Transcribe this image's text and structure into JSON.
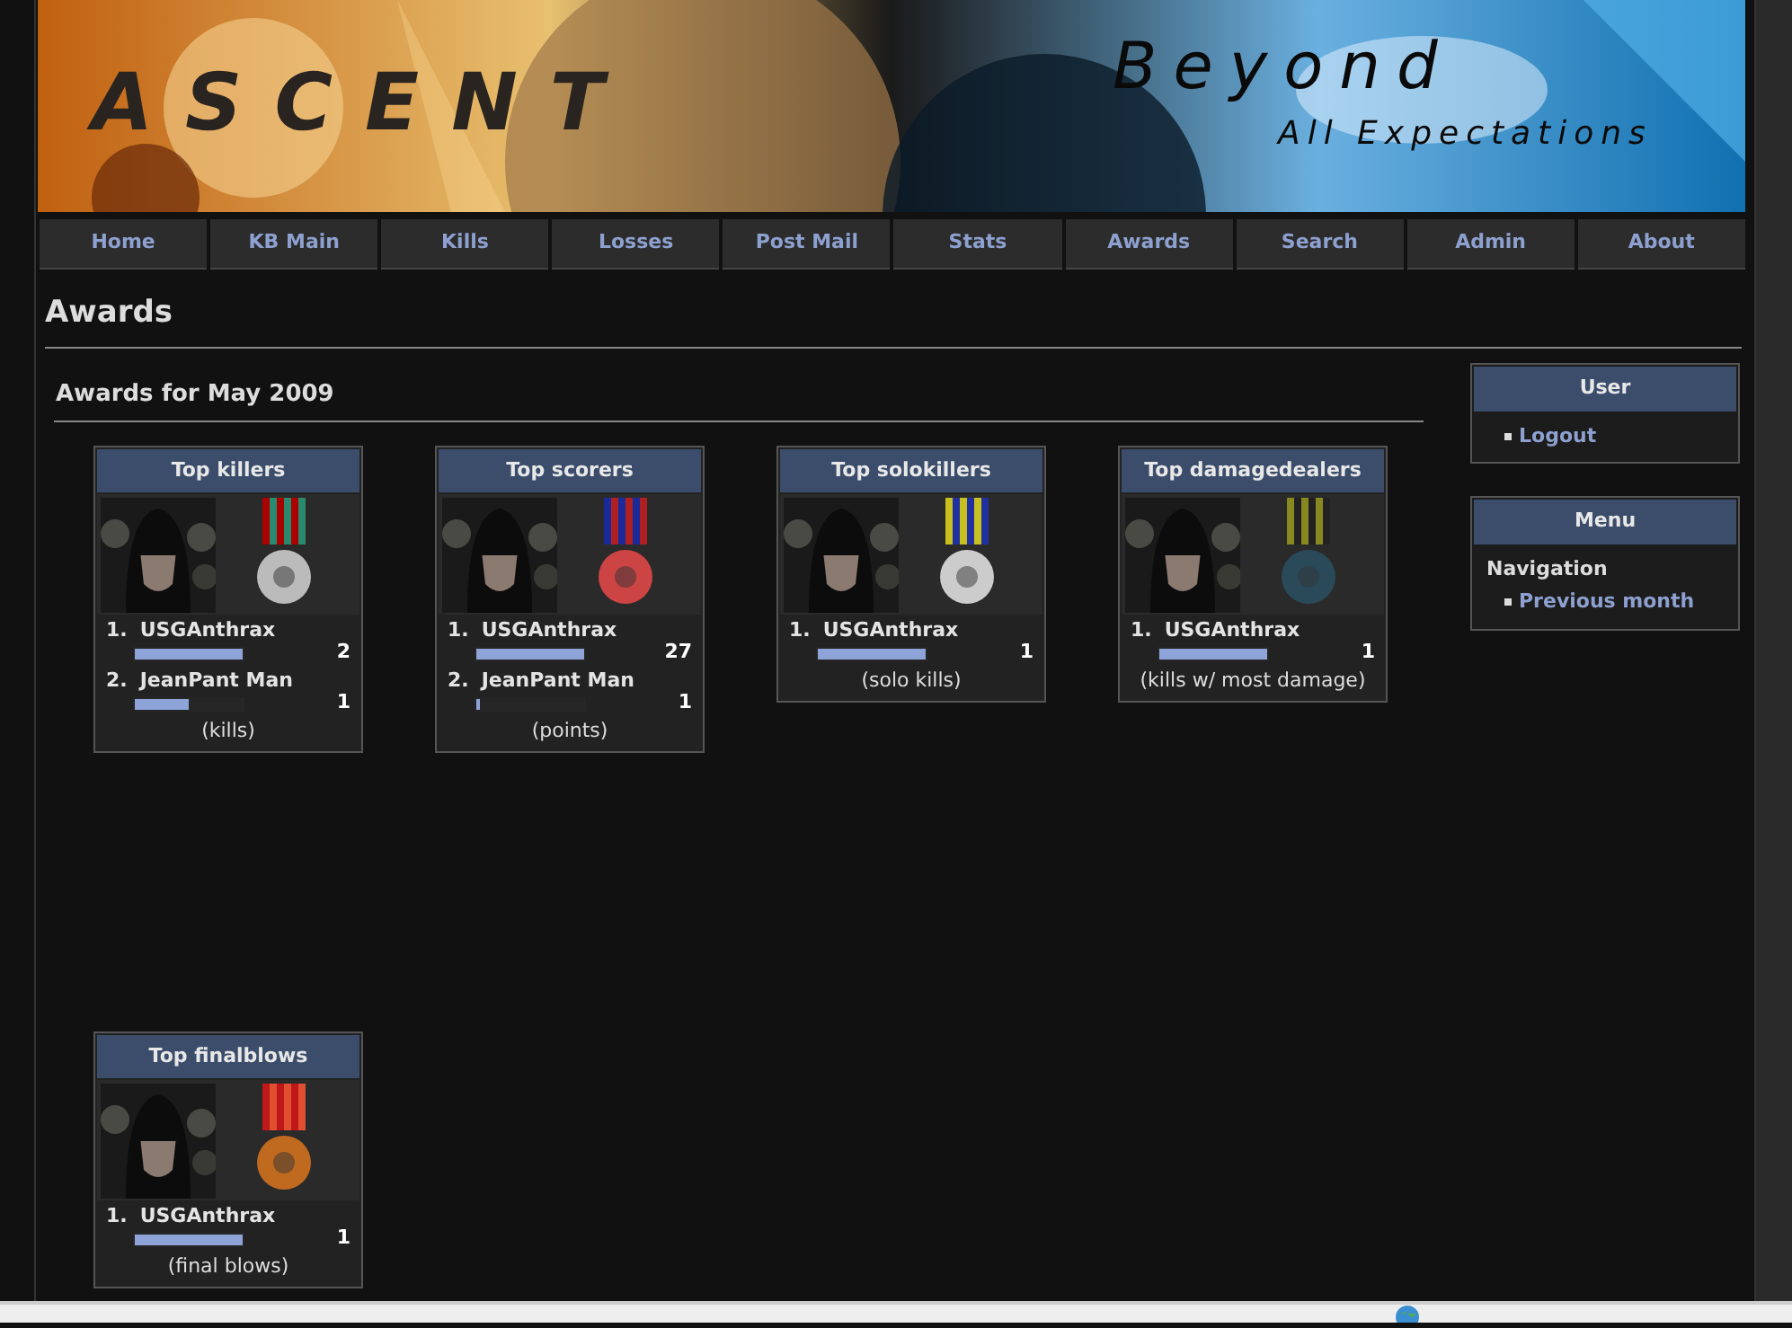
{
  "banner": {
    "logo": "ASCENT",
    "tagline_1": "Beyond",
    "tagline_2": "All Expectations"
  },
  "nav": [
    {
      "label": "Home"
    },
    {
      "label": "KB Main"
    },
    {
      "label": "Kills"
    },
    {
      "label": "Losses"
    },
    {
      "label": "Post Mail"
    },
    {
      "label": "Stats"
    },
    {
      "label": "Awards"
    },
    {
      "label": "Search"
    },
    {
      "label": "Admin"
    },
    {
      "label": "About"
    }
  ],
  "page_title": "Awards",
  "section_title": "Awards for May 2009",
  "awards": [
    {
      "title": "Top killers",
      "entries": [
        {
          "rank": "1.",
          "name": "USGAnthrax",
          "level": 1,
          "value": "2"
        },
        {
          "rank": "2.",
          "name": "JeanPant Man",
          "level": 0.5,
          "value": "1"
        }
      ],
      "unit": "(kills)"
    },
    {
      "title": "Top scorers",
      "entries": [
        {
          "rank": "1.",
          "name": "USGAnthrax",
          "level": 1,
          "value": "27"
        },
        {
          "rank": "2.",
          "name": "JeanPant Man",
          "level": 0.04,
          "value": "1"
        }
      ],
      "unit": "(points)"
    },
    {
      "title": "Top solokillers",
      "entries": [
        {
          "rank": "1.",
          "name": "USGAnthrax",
          "level": 1,
          "value": "1"
        }
      ],
      "unit": "(solo kills)"
    },
    {
      "title": "Top damagedealers",
      "entries": [
        {
          "rank": "1.",
          "name": "USGAnthrax",
          "level": 1,
          "value": "1"
        }
      ],
      "unit": "(kills w/ most damage)"
    },
    {
      "title": "Top finalblows",
      "entries": [
        {
          "rank": "1.",
          "name": "USGAnthrax",
          "level": 1,
          "value": "1"
        }
      ],
      "unit": "(final blows)"
    }
  ],
  "sidebar": [
    {
      "title": "User",
      "links": [
        "Logout"
      ]
    },
    {
      "title": "Menu",
      "heading": "Navigation",
      "links": [
        "Previous month"
      ]
    }
  ]
}
